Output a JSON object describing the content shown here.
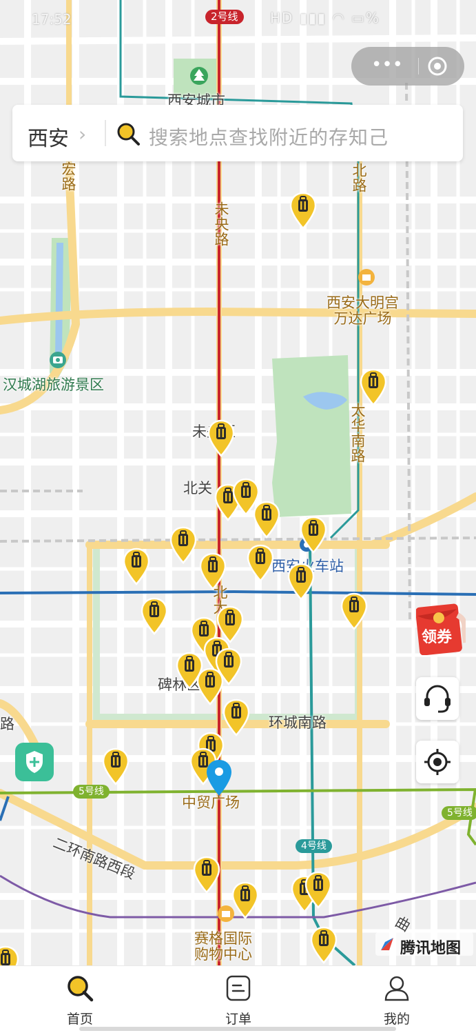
{
  "status_bar": {
    "time": "17:52",
    "icons": [
      "hd-icon",
      "signal-icon",
      "wifi-icon",
      "battery-icon"
    ],
    "battery_text": "%"
  },
  "capsule": {
    "more_label": "•••",
    "close_icon": "target-circle-icon"
  },
  "search": {
    "city": "西安",
    "chevron": "›",
    "placeholder": "搜索地点查找附近的存知己",
    "icon": "search-icon"
  },
  "map": {
    "metro_badges": {
      "line2": "2号线",
      "line4": "4号线",
      "line5_left": "5号线",
      "line5_right": "5号线"
    },
    "colors": {
      "line2": "#c8242c",
      "line4": "#2a9a9a",
      "line5": "#7fb22f",
      "line_blue": "#2a6fb5",
      "line_purple": "#7d5aa6",
      "road_main": "#f8d98e",
      "pin_fill": "#f2c428",
      "pin_dark": "#2b2b2b",
      "location_pin": "#1a9be3",
      "park_green": "#bfe3bd"
    },
    "labels": {
      "xian_city_center": "西安城市",
      "wei_yang_road": "未央路",
      "bei_road": "北路",
      "hong_road": "宏路",
      "daming_palace": "西安大明宫\n万达广场",
      "hancheng_lake": "汉城湖旅游景区",
      "taihua_road": "太华南路",
      "weiyang_district": "未央区",
      "beiguan": "北关",
      "xian_station": "西安火车站",
      "bei_da": "北大",
      "beilin": "碑林区",
      "huancheng_south": "环城南路",
      "road_edge": "路",
      "zhongmao": "中贸广场",
      "second_ring_west": "二环南路西段",
      "saige": "赛格国际\n购物中心",
      "qu_road": "曲"
    },
    "poi_icons": [
      "tree-icon",
      "shopping-bag-icon",
      "camera-icon",
      "shopping-bag-icon"
    ]
  },
  "side_buttons": {
    "coupon_label": "领券",
    "support_icon": "headset-icon",
    "locate_icon": "locate-icon",
    "safety_icon": "shield-icon"
  },
  "attribution": {
    "text": "腾讯地图"
  },
  "tabbar": {
    "tabs": [
      {
        "label": "首页",
        "icon": "search-icon",
        "active": true
      },
      {
        "label": "订单",
        "icon": "order-icon",
        "active": false
      },
      {
        "label": "我的",
        "icon": "profile-icon",
        "active": false
      }
    ]
  }
}
